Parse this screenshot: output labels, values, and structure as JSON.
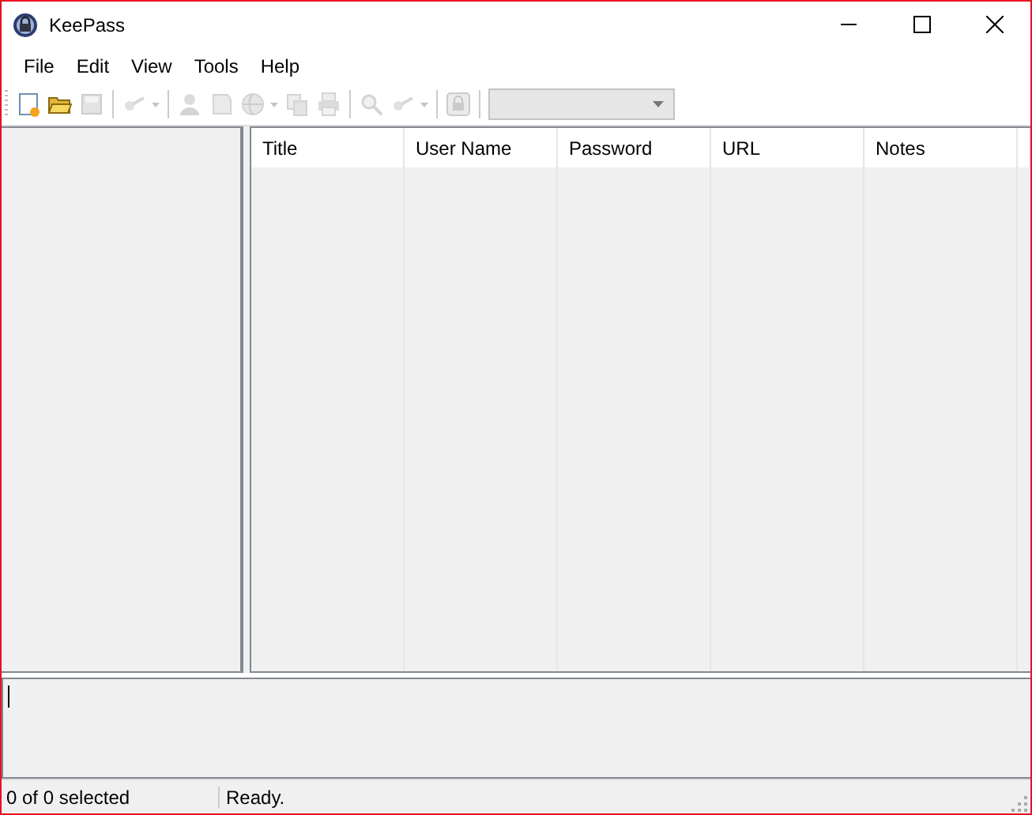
{
  "window": {
    "title": "KeePass"
  },
  "menu": [
    {
      "label": "File"
    },
    {
      "label": "Edit"
    },
    {
      "label": "View"
    },
    {
      "label": "Tools"
    },
    {
      "label": "Help"
    }
  ],
  "toolbar": [
    {
      "kind": "new",
      "disabled": false
    },
    {
      "kind": "open",
      "disabled": false
    },
    {
      "kind": "save",
      "disabled": true
    },
    {
      "kind": "separator"
    },
    {
      "kind": "key",
      "disabled": true,
      "dropdown": true
    },
    {
      "kind": "separator"
    },
    {
      "kind": "user",
      "disabled": true
    },
    {
      "kind": "page",
      "disabled": true
    },
    {
      "kind": "globe",
      "disabled": true,
      "dropdown": true
    },
    {
      "kind": "copy",
      "disabled": true
    },
    {
      "kind": "printer",
      "disabled": true
    },
    {
      "kind": "separator"
    },
    {
      "kind": "search",
      "disabled": true
    },
    {
      "kind": "key",
      "disabled": true,
      "dropdown": true
    },
    {
      "kind": "separator"
    },
    {
      "kind": "lock",
      "disabled": true
    },
    {
      "kind": "separator"
    },
    {
      "kind": "combo",
      "disabled": true
    }
  ],
  "table": {
    "columns": [
      "Title",
      "User Name",
      "Password",
      "URL",
      "Notes"
    ]
  },
  "status_bar": {
    "selection": "0 of 0 selected",
    "message": "Ready."
  }
}
